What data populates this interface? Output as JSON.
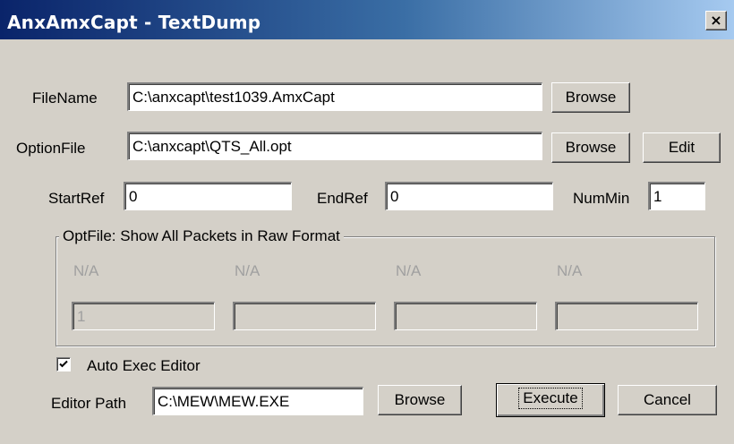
{
  "window": {
    "title": "AnxAmxCapt - TextDump",
    "close_glyph": "×"
  },
  "file": {
    "label": "FileName",
    "value": "C:\\anxcapt\\test1039.AmxCapt",
    "browse_label": "Browse"
  },
  "option": {
    "label": "OptionFile",
    "value": "C:\\anxcapt\\QTS_All.opt",
    "browse_label": "Browse",
    "edit_label": "Edit"
  },
  "refs": {
    "start_label": "StartRef",
    "start_value": "0",
    "end_label": "EndRef",
    "end_value": "0",
    "nummin_label": "NumMin",
    "nummin_value": "1"
  },
  "optfile_group": {
    "title": "OptFile:  Show All Packets in Raw Format",
    "params": [
      {
        "label": "N/A",
        "value": "1"
      },
      {
        "label": "N/A",
        "value": ""
      },
      {
        "label": "N/A",
        "value": ""
      },
      {
        "label": "N/A",
        "value": ""
      }
    ]
  },
  "auto_exec": {
    "label": "Auto Exec Editor",
    "checked": true
  },
  "editor": {
    "label": "Editor Path",
    "value": "C:\\MEW\\MEW.EXE",
    "browse_label": "Browse"
  },
  "actions": {
    "execute_label": "Execute",
    "cancel_label": "Cancel"
  }
}
